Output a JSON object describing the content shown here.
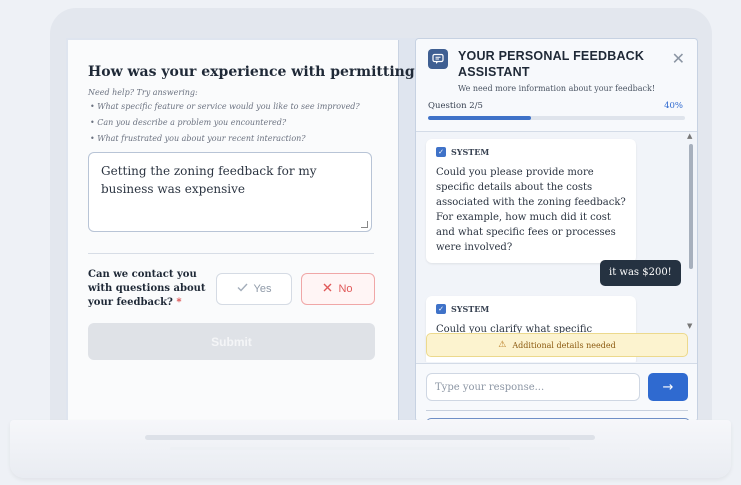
{
  "form": {
    "question": "How was your experience with permitting?",
    "help_label": "Need help? Try answering:",
    "hints": [
      "• What specific feature or service would you like to see improved?",
      "• Can you describe a problem you encountered?",
      "• What frustrated you about your recent interaction?"
    ],
    "answer_value": "Getting the zoning feedback for my business was expensive",
    "contact_label": "Can we contact you with questions about your feedback?",
    "required_mark": "*",
    "yes_label": "Yes",
    "no_label": "No",
    "submit_label": "Submit"
  },
  "assistant": {
    "title": "YOUR PERSONAL FEEDBACK ASSISTANT",
    "subtitle": "We need more information about your feedback!",
    "progress_label": "Question 2/5",
    "progress_percent_label": "40%",
    "progress_fraction": 0.4,
    "messages": [
      {
        "role": "SYSTEM",
        "text": "Could you please provide more specific details about the costs associated with the zoning feedback? For example, how much did it cost and what specific fees or processes were involved?"
      },
      {
        "role": "user",
        "text": "it was $200!"
      },
      {
        "role": "SYSTEM",
        "text": "Could you clarify what specific zoning"
      }
    ],
    "alert": "Additional details needed",
    "input_placeholder": "Type your response...",
    "colors": {
      "accent": "#2f6ad0",
      "user_bubble": "#253241",
      "alert_bg": "#fcf3cf"
    }
  }
}
